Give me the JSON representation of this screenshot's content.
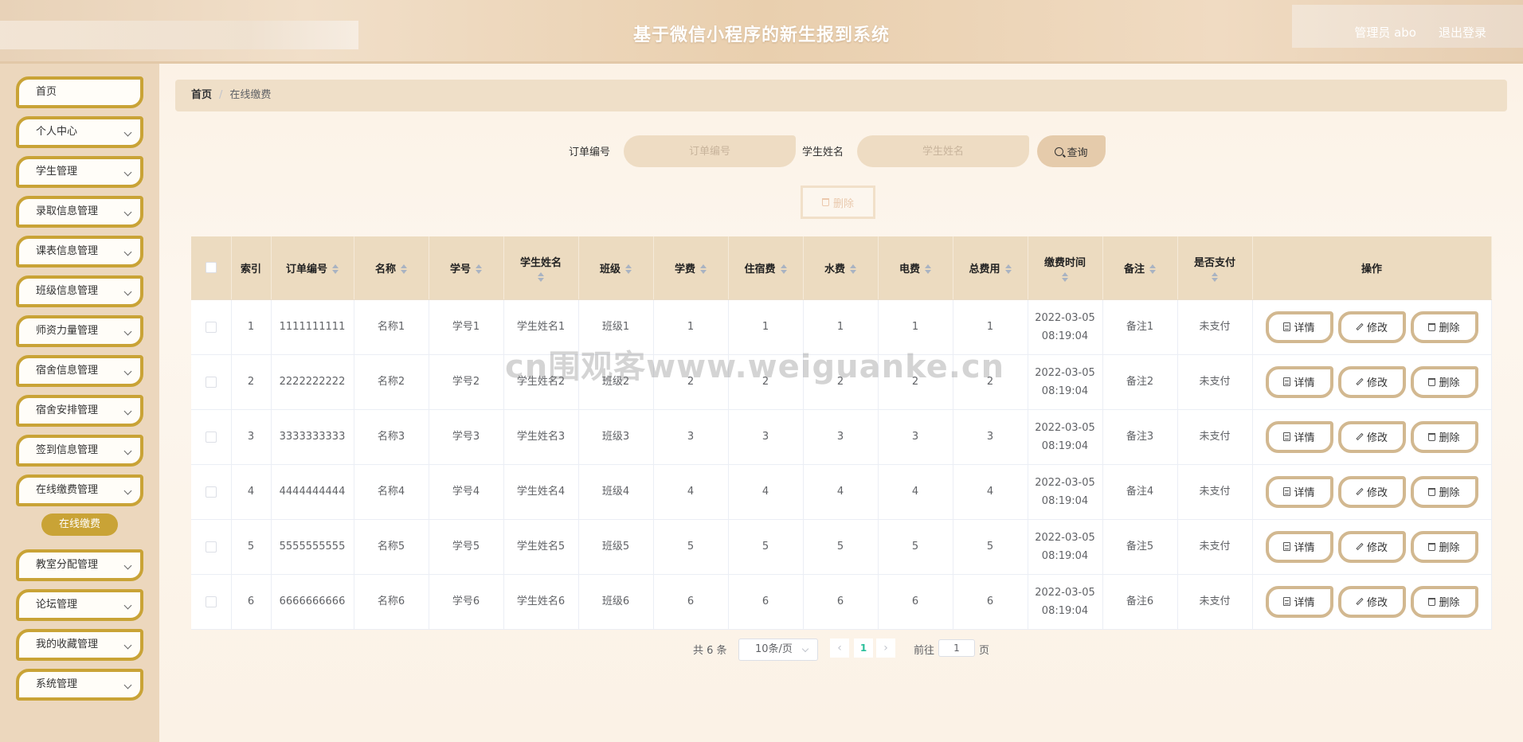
{
  "header": {
    "title": "基于微信小程序的新生报到系统",
    "user": "管理员 abo",
    "logout": "退出登录"
  },
  "sidebar": {
    "items": [
      {
        "label": "首页",
        "has_sub": false
      },
      {
        "label": "个人中心",
        "has_sub": true
      },
      {
        "label": "学生管理",
        "has_sub": true
      },
      {
        "label": "录取信息管理",
        "has_sub": true
      },
      {
        "label": "课表信息管理",
        "has_sub": true
      },
      {
        "label": "班级信息管理",
        "has_sub": true
      },
      {
        "label": "师资力量管理",
        "has_sub": true
      },
      {
        "label": "宿舍信息管理",
        "has_sub": true
      },
      {
        "label": "宿舍安排管理",
        "has_sub": true
      },
      {
        "label": "签到信息管理",
        "has_sub": true
      },
      {
        "label": "在线缴费管理",
        "has_sub": true
      },
      {
        "label": "教室分配管理",
        "has_sub": true
      },
      {
        "label": "论坛管理",
        "has_sub": true
      },
      {
        "label": "我的收藏管理",
        "has_sub": true
      },
      {
        "label": "系统管理",
        "has_sub": true
      }
    ],
    "active_sub": "在线缴费"
  },
  "breadcrumb": {
    "home": "首页",
    "separator": "/",
    "current": "在线缴费"
  },
  "search": {
    "order_label": "订单编号",
    "order_placeholder": "订单编号",
    "name_label": "学生姓名",
    "name_placeholder": "学生姓名",
    "button": "查询"
  },
  "bulk_delete": "删除",
  "table": {
    "headers": [
      "索引",
      "订单编号",
      "名称",
      "学号",
      "学生姓名",
      "班级",
      "学费",
      "住宿费",
      "水费",
      "电费",
      "总费用",
      "缴费时间",
      "备注",
      "是否支付",
      "操作"
    ],
    "rows": [
      {
        "index": "1",
        "order": "1111111111",
        "name": "名称1",
        "sid": "学号1",
        "sname": "学生姓名1",
        "cls": "班级1",
        "tuition": "1",
        "lodging": "1",
        "water": "1",
        "power": "1",
        "total": "1",
        "time": "2022-03-05 08:19:04",
        "note": "备注1",
        "paid": "未支付"
      },
      {
        "index": "2",
        "order": "2222222222",
        "name": "名称2",
        "sid": "学号2",
        "sname": "学生姓名2",
        "cls": "班级2",
        "tuition": "2",
        "lodging": "2",
        "water": "2",
        "power": "2",
        "total": "2",
        "time": "2022-03-05 08:19:04",
        "note": "备注2",
        "paid": "未支付"
      },
      {
        "index": "3",
        "order": "3333333333",
        "name": "名称3",
        "sid": "学号3",
        "sname": "学生姓名3",
        "cls": "班级3",
        "tuition": "3",
        "lodging": "3",
        "water": "3",
        "power": "3",
        "total": "3",
        "time": "2022-03-05 08:19:04",
        "note": "备注3",
        "paid": "未支付"
      },
      {
        "index": "4",
        "order": "4444444444",
        "name": "名称4",
        "sid": "学号4",
        "sname": "学生姓名4",
        "cls": "班级4",
        "tuition": "4",
        "lodging": "4",
        "water": "4",
        "power": "4",
        "total": "4",
        "time": "2022-03-05 08:19:04",
        "note": "备注4",
        "paid": "未支付"
      },
      {
        "index": "5",
        "order": "5555555555",
        "name": "名称5",
        "sid": "学号5",
        "sname": "学生姓名5",
        "cls": "班级5",
        "tuition": "5",
        "lodging": "5",
        "water": "5",
        "power": "5",
        "total": "5",
        "time": "2022-03-05 08:19:04",
        "note": "备注5",
        "paid": "未支付"
      },
      {
        "index": "6",
        "order": "6666666666",
        "name": "名称6",
        "sid": "学号6",
        "sname": "学生姓名6",
        "cls": "班级6",
        "tuition": "6",
        "lodging": "6",
        "water": "6",
        "power": "6",
        "total": "6",
        "time": "2022-03-05 08:19:04",
        "note": "备注6",
        "paid": "未支付"
      }
    ],
    "actions": {
      "detail": "详情",
      "edit": "修改",
      "delete": "删除"
    }
  },
  "pagination": {
    "total": "共 6 条",
    "page_size": "10条/页",
    "current_page": "1",
    "goto_label": "前往",
    "goto_value": "1",
    "page_unit": "页"
  },
  "watermark": "cn围观客www.weiguanke.cn",
  "colors": {
    "accent": "#c9a336",
    "header": "#e9cfae",
    "table_header": "#ecdbc0",
    "page_active": "#2abf9a"
  }
}
